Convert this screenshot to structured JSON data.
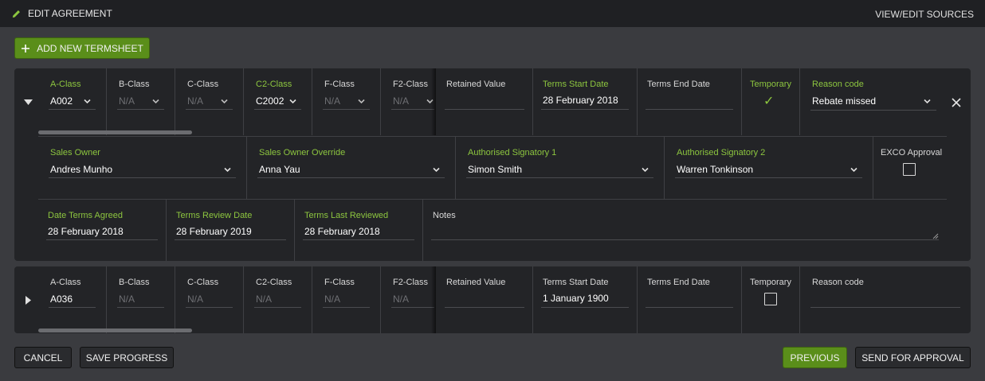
{
  "header": {
    "title": "EDIT AGREEMENT",
    "view_edit_sources": "VIEW/EDIT SOURCES"
  },
  "add_termsheet_label": "ADD NEW TERMSHEET",
  "termsheet1": {
    "classes": [
      {
        "label": "A-Class",
        "value": "A002",
        "active": true
      },
      {
        "label": "B-Class",
        "value": "N/A",
        "active": false
      },
      {
        "label": "C-Class",
        "value": "N/A",
        "active": false
      },
      {
        "label": "C2-Class",
        "value": "C2002",
        "active": true
      },
      {
        "label": "F-Class",
        "value": "N/A",
        "active": false
      },
      {
        "label": "F2-Class",
        "value": "N/A",
        "active": false
      }
    ],
    "retained_value": {
      "label": "Retained Value",
      "value": ""
    },
    "terms_start_date": {
      "label": "Terms Start Date",
      "value": "28 February 2018"
    },
    "terms_end_date": {
      "label": "Terms End Date",
      "value": ""
    },
    "temporary": {
      "label": "Temporary",
      "checked": true,
      "check_glyph": "✓"
    },
    "reason_code": {
      "label": "Reason code",
      "value": "Rebate missed"
    },
    "sales_owner": {
      "label": "Sales Owner",
      "value": "Andres Munho"
    },
    "sales_owner_override": {
      "label": "Sales Owner Override",
      "value": "Anna Yau"
    },
    "authorised_signatory_1": {
      "label": "Authorised Signatory 1",
      "value": "Simon Smith"
    },
    "authorised_signatory_2": {
      "label": "Authorised Signatory 2",
      "value": "Warren Tonkinson"
    },
    "exco_approval": {
      "label": "EXCO Approval",
      "checked": false
    },
    "date_terms_agreed": {
      "label": "Date Terms Agreed",
      "value": "28 February 2018"
    },
    "terms_review_date": {
      "label": "Terms Review Date",
      "value": "28 February 2019"
    },
    "terms_last_reviewed": {
      "label": "Terms Last Reviewed",
      "value": "28 February 2018"
    },
    "notes": {
      "label": "Notes",
      "value": ""
    }
  },
  "termsheet2": {
    "classes": [
      {
        "label": "A-Class",
        "value": "A036",
        "active": true
      },
      {
        "label": "B-Class",
        "value": "N/A",
        "active": false
      },
      {
        "label": "C-Class",
        "value": "N/A",
        "active": false
      },
      {
        "label": "C2-Class",
        "value": "N/A",
        "active": false
      },
      {
        "label": "F-Class",
        "value": "N/A",
        "active": false
      },
      {
        "label": "F2-Class",
        "value": "N/A",
        "active": false
      }
    ],
    "retained_value": {
      "label": "Retained Value",
      "value": ""
    },
    "terms_start_date": {
      "label": "Terms Start Date",
      "value": "1 January 1900"
    },
    "terms_end_date": {
      "label": "Terms End Date",
      "value": ""
    },
    "temporary": {
      "label": "Temporary",
      "checked": false
    },
    "reason_code": {
      "label": "Reason code",
      "value": ""
    }
  },
  "footer": {
    "cancel": "CANCEL",
    "save_progress": "SAVE PROGRESS",
    "previous": "PREVIOUS",
    "send_for_approval": "SEND FOR APPROVAL"
  },
  "colors": {
    "accent_green": "#8dc63f",
    "button_green": "#5a8e1a",
    "panel": "#232427",
    "background": "#3a3b3f"
  }
}
